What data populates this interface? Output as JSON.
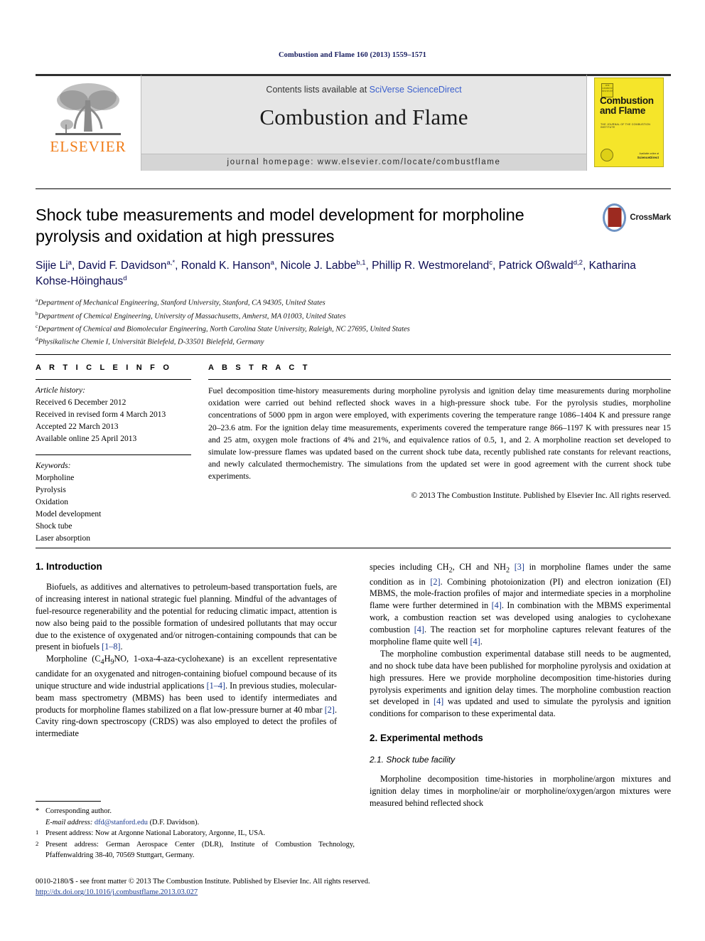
{
  "running_head": "Combustion and Flame 160 (2013) 1559–1571",
  "masthead": {
    "publisher_logo_text": "ELSEVIER",
    "contents_prefix": "Contents lists available at ",
    "contents_link": "SciVerse ScienceDirect",
    "journal_title": "Combustion and Flame",
    "homepage": "journal homepage: www.elsevier.com/locate/combustflame",
    "cover": {
      "badge_text": "THE COMBUSTION INSTITUTE",
      "title_line1": "Combustion",
      "title_line2": "and Flame",
      "subtitle": "THE JOURNAL OF THE COMBUSTION INSTITUTE",
      "footer_small": "Available online at",
      "footer_brand": "ScienceDirect"
    }
  },
  "article": {
    "title": "Shock tube measurements and model development for morpholine pyrolysis and oxidation at high pressures",
    "crossmark_label": "CrossMark",
    "authors_html": "Sijie Li<sup>a</sup>, David F. Davidson<sup>a,</sup><sup>*</sup>, Ronald K. Hanson<sup>a</sup>, Nicole J. Labbe<sup>b,1</sup>, Phillip R. Westmoreland<sup>c</sup>, Patrick Oßwald<sup>d,2</sup>, Katharina Kohse-Höinghaus<sup>d</sup>",
    "affiliations": [
      {
        "mark": "a",
        "text": "Department of Mechanical Engineering, Stanford University, Stanford, CA 94305, United States"
      },
      {
        "mark": "b",
        "text": "Department of Chemical Engineering, University of Massachusetts, Amherst, MA 01003, United States"
      },
      {
        "mark": "c",
        "text": "Department of Chemical and Biomolecular Engineering, North Carolina State University, Raleigh, NC 27695, United States"
      },
      {
        "mark": "d",
        "text": "Physikalische Chemie I, Universität Bielefeld, D-33501 Bielefeld, Germany"
      }
    ]
  },
  "article_info": {
    "heading": "A R T I C L E    I N F O",
    "history_label": "Article history:",
    "history": [
      "Received 6 December 2012",
      "Received in revised form 4 March 2013",
      "Accepted 22 March 2013",
      "Available online 25 April 2013"
    ],
    "keywords_label": "Keywords:",
    "keywords": [
      "Morpholine",
      "Pyrolysis",
      "Oxidation",
      "Model development",
      "Shock tube",
      "Laser absorption"
    ]
  },
  "abstract": {
    "heading": "A B S T R A C T",
    "text": "Fuel decomposition time-history measurements during morpholine pyrolysis and ignition delay time measurements during morpholine oxidation were carried out behind reflected shock waves in a high-pressure shock tube. For the pyrolysis studies, morpholine concentrations of 5000 ppm in argon were employed, with experiments covering the temperature range 1086–1404 K and pressure range 20–23.6 atm. For the ignition delay time measurements, experiments covered the temperature range 866–1197 K with pressures near 15 and 25 atm, oxygen mole fractions of 4% and 21%, and equivalence ratios of 0.5, 1, and 2. A morpholine reaction set developed to simulate low-pressure flames was updated based on the current shock tube data, recently published rate constants for relevant reactions, and newly calculated thermochemistry. The simulations from the updated set were in good agreement with the current shock tube experiments.",
    "copyright": "© 2013 The Combustion Institute. Published by Elsevier Inc. All rights reserved."
  },
  "body": {
    "left_column": {
      "section_heading": "1. Introduction",
      "paragraph_1_html": "Biofuels, as additives and alternatives to petroleum-based transportation fuels, are of increasing interest in national strategic fuel planning. Mindful of the advantages of fuel-resource regenerability and the potential for reducing climatic impact, attention is now also being paid to the possible formation of undesired pollutants that may occur due to the existence of oxygenated and/or nitrogen-containing compounds that can be present in biofuels <span class=\"ref\">[1–8]</span>.",
      "paragraph_2_html": "Morpholine (C<sub>4</sub>H<sub>9</sub>NO, 1-oxa-4-aza-cyclohexane) is an excellent representative candidate for an oxygenated and nitrogen-containing biofuel compound because of its unique structure and wide industrial applications <span class=\"ref\">[1–4]</span>. In previous studies, molecular-beam mass spectrometry (MBMS) has been used to identify intermediates and products for morpholine flames stabilized on a flat low-pressure burner at 40 mbar <span class=\"ref\">[2]</span>. Cavity ring-down spectroscopy (CRDS) was also employed to detect the profiles of intermediate"
    },
    "right_column": {
      "paragraph_1_html": "species including CH<sub>2</sub>, CH and NH<sub>2</sub> <span class=\"ref\">[3]</span> in morpholine flames under the same condition as in <span class=\"ref\">[2]</span>. Combining photoionization (PI) and electron ionization (EI) MBMS, the mole-fraction profiles of major and intermediate species in a morpholine flame were further determined in <span class=\"ref\">[4]</span>. In combination with the MBMS experimental work, a combustion reaction set was developed using analogies to cyclohexane combustion <span class=\"ref\">[4]</span>. The reaction set for morpholine captures relevant features of the morpholine flame quite well <span class=\"ref\">[4]</span>.",
      "paragraph_2_html": "The morpholine combustion experimental database still needs to be augmented, and no shock tube data have been published for morpholine pyrolysis and oxidation at high pressures. Here we provide morpholine decomposition time-histories during pyrolysis experiments and ignition delay times. The morpholine combustion reaction set developed in <span class=\"ref\">[4]</span> was updated and used to simulate the pyrolysis and ignition conditions for comparison to these experimental data.",
      "section_heading": "2. Experimental methods",
      "subsection_heading": "2.1. Shock tube facility",
      "paragraph_3_html": "Morpholine decomposition time-histories in morpholine/argon mixtures and ignition delay times in morpholine/air or morpholine/oxygen/argon mixtures were measured behind reflected shock"
    }
  },
  "footnotes": {
    "corresponding_mark": "*",
    "corresponding_text": "Corresponding author.",
    "email_label": "E-mail address:",
    "email": "dfd@stanford.edu",
    "email_owner": "(D.F. Davidson).",
    "note1_mark": "1",
    "note1_text": "Present address: Now at Argonne National Laboratory, Argonne, IL, USA.",
    "note2_mark": "2",
    "note2_text": "Present address: German Aerospace Center (DLR), Institute of Combustion Technology, Pfaffenwaldring 38-40, 70569 Stuttgart, Germany."
  },
  "footer": {
    "issn_line": "0010-2180/$ - see front matter © 2013 The Combustion Institute. Published by Elsevier Inc. All rights reserved.",
    "doi": "http://dx.doi.org/10.1016/j.combustflame.2013.03.027"
  },
  "colors": {
    "link_blue": "#3a5fcd",
    "ref_blue": "#1a3a8f",
    "elsevier_orange": "#f07d1a",
    "cover_yellow": "#f5e52a",
    "running_head_navy": "#151b5e"
  }
}
